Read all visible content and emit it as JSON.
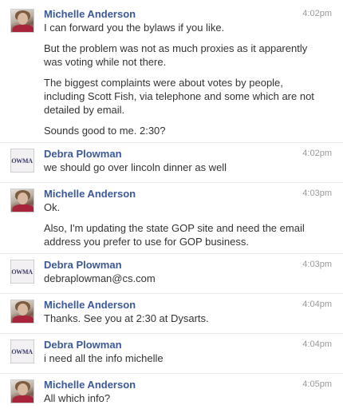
{
  "messages": [
    {
      "sender": "Michelle Anderson",
      "time": "4:02pm",
      "avatar": "michelle",
      "lines": [
        "I can forward you the bylaws if you like.",
        "But the problem was not as much proxies as it apparently was voting while not there.",
        "The biggest complaints were about votes by people, including Scott Fish, via telephone and some which are not detailed by email.",
        "Sounds good to me. 2:30?"
      ]
    },
    {
      "sender": "Debra Plowman",
      "time": "4:02pm",
      "avatar": "debra",
      "lines": [
        "we should go over lincoln dinner as well"
      ]
    },
    {
      "sender": "Michelle Anderson",
      "time": "4:03pm",
      "avatar": "michelle",
      "lines": [
        "Ok.",
        "Also, I'm updating the state GOP site and need the email address you prefer to use for GOP business."
      ]
    },
    {
      "sender": "Debra Plowman",
      "time": "4:03pm",
      "avatar": "debra",
      "lines": [
        "debraplowman@cs.com"
      ]
    },
    {
      "sender": "Michelle Anderson",
      "time": "4:04pm",
      "avatar": "michelle",
      "lines": [
        "Thanks. See you at 2:30 at Dysarts."
      ]
    },
    {
      "sender": "Debra Plowman",
      "time": "4:04pm",
      "avatar": "debra",
      "lines": [
        "i need all the info michelle"
      ]
    },
    {
      "sender": "Michelle Anderson",
      "time": "4:05pm",
      "avatar": "michelle",
      "lines": [
        "All which info?"
      ]
    }
  ],
  "avatars": {
    "debra_text": "LOWMA"
  },
  "colors": {
    "sender_name": "#3b5998",
    "timestamp": "#999999",
    "message_text": "#333333"
  }
}
